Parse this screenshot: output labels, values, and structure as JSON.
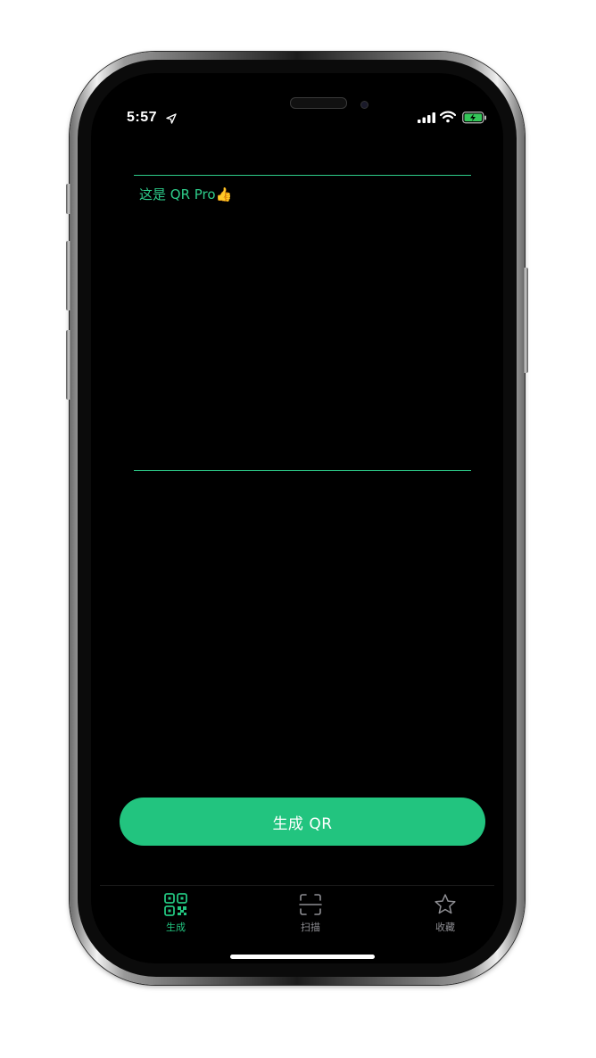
{
  "status_bar": {
    "time": "5:57",
    "location_icon": "location-arrow-icon",
    "signal_icon": "cellular-signal-icon",
    "wifi_icon": "wifi-icon",
    "battery_icon": "battery-charging-icon"
  },
  "editor": {
    "text": "这是 QR Pro👍"
  },
  "generate_button": {
    "label": "生成 QR"
  },
  "tabbar": {
    "items": [
      {
        "label": "生成",
        "icon": "qr-code-icon",
        "active": true
      },
      {
        "label": "扫描",
        "icon": "scan-frame-icon",
        "active": false
      },
      {
        "label": "收藏",
        "icon": "star-icon",
        "active": false
      }
    ]
  },
  "colors": {
    "accent": "#22c47f",
    "accent_text": "#2ecc8a",
    "inactive": "#8e8e93",
    "background": "#000000"
  }
}
